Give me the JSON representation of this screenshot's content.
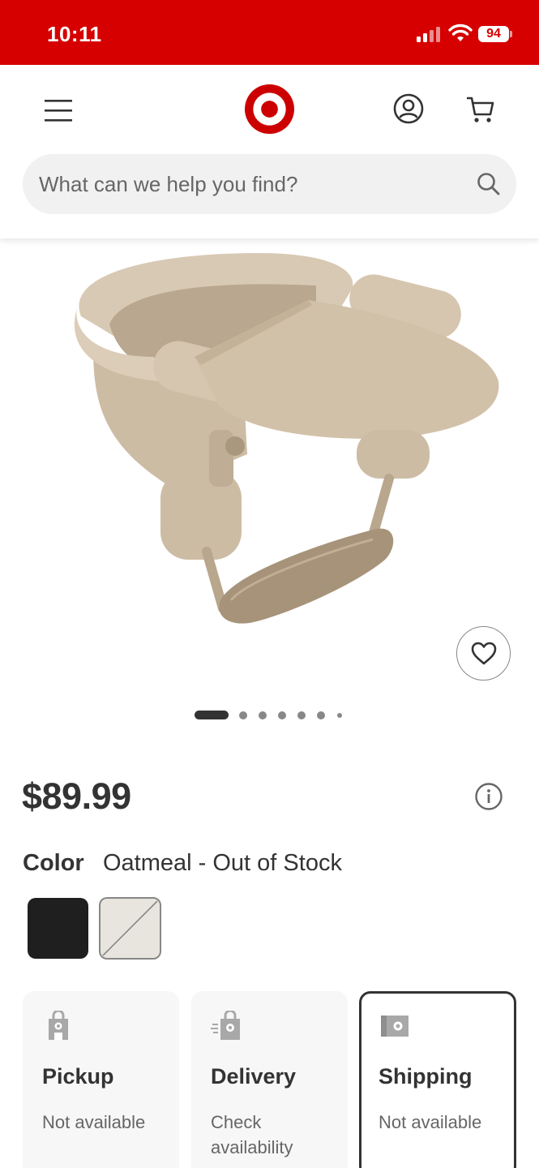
{
  "status_bar": {
    "time": "10:11",
    "battery": "94",
    "background_color": "#d60000"
  },
  "header": {
    "menu_icon": "hamburger-menu-icon",
    "logo": "target-bullseye-logo",
    "account_icon": "account-icon",
    "cart_icon": "cart-icon",
    "search": {
      "placeholder": "What can we help you find?",
      "icon": "search-icon"
    }
  },
  "product": {
    "image_alt": "clip-on table high chair",
    "favorite_icon": "heart-icon",
    "carousel": {
      "total_slides": 7,
      "active_index": 0
    },
    "price": "$89.99",
    "info_icon": "info-icon",
    "color": {
      "label": "Color",
      "value": "Oatmeal - Out of Stock",
      "swatches": [
        {
          "name": "Black",
          "color": "#1f1f1f",
          "selected": false
        },
        {
          "name": "Oatmeal",
          "color": "#e8e4de",
          "selected": true,
          "out_of_stock": true
        }
      ]
    }
  },
  "fulfillment": [
    {
      "title": "Pickup",
      "subtitle": "Not available",
      "icon": "store-pickup-icon",
      "selected": false
    },
    {
      "title": "Delivery",
      "subtitle": "Check availability",
      "icon": "same-day-delivery-icon",
      "selected": false
    },
    {
      "title": "Shipping",
      "subtitle": "Not available",
      "icon": "shipping-box-icon",
      "selected": true
    }
  ],
  "colors": {
    "brand_red": "#cc0000",
    "text_primary": "#333333",
    "text_secondary": "#666666"
  }
}
